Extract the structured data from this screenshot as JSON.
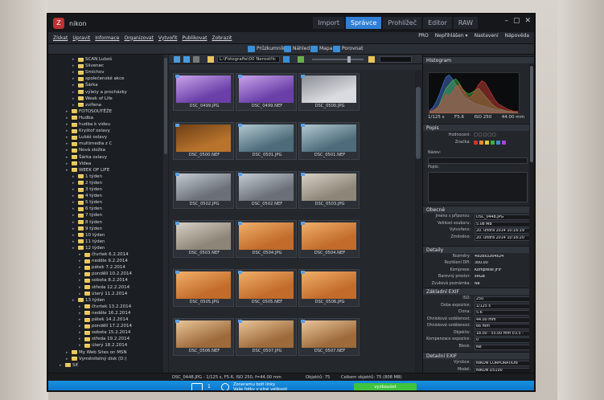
{
  "app": {
    "title": "nikon",
    "logo_letter": "Z"
  },
  "modes": [
    "Import",
    "Správce",
    "Prohlížeč",
    "Editor",
    "RAW"
  ],
  "active_mode": 1,
  "menu": [
    "Získat",
    "Upravit",
    "Informace",
    "Organizovat",
    "Vytvořit",
    "Publikovat",
    "Zobrazit"
  ],
  "menu_right": [
    "PRO",
    "Nepřihlášen ▾",
    "Nastavení",
    "Nápověda"
  ],
  "toolbar": {
    "items": [
      "Průzkumník",
      "Náhled",
      "Mapa",
      "Porovnat"
    ]
  },
  "path": {
    "value": "L:\\Fotografie\\00 Nerostříc"
  },
  "tree": [
    {
      "label": "SCAN Luboš",
      "indent": 2
    },
    {
      "label": "Slivenec",
      "indent": 2
    },
    {
      "label": "Smíchov",
      "indent": 2
    },
    {
      "label": "společenské akce",
      "indent": 2
    },
    {
      "label": "Šárka",
      "indent": 2
    },
    {
      "label": "výlety a procházky",
      "indent": 2
    },
    {
      "label": "Week of Life",
      "indent": 2
    },
    {
      "label": "zvířena",
      "indent": 2
    },
    {
      "label": "FOTOSOUTĚŽE",
      "indent": 1
    },
    {
      "label": "Hudba",
      "indent": 1
    },
    {
      "label": "hudba k videu",
      "indent": 1
    },
    {
      "label": "Kryštof oslavy",
      "indent": 1
    },
    {
      "label": "Lukáš oslavy",
      "indent": 1
    },
    {
      "label": "multimedia z C",
      "indent": 1
    },
    {
      "label": "Nová složka",
      "indent": 1
    },
    {
      "label": "Šárka oslavy",
      "indent": 1
    },
    {
      "label": "Videa",
      "indent": 1
    },
    {
      "label": "WEEK OF LIFE",
      "indent": 1
    },
    {
      "label": "1 týden",
      "indent": 2
    },
    {
      "label": "2 týden",
      "indent": 2
    },
    {
      "label": "3 týden",
      "indent": 2
    },
    {
      "label": "4 týden",
      "indent": 2
    },
    {
      "label": "5 týden",
      "indent": 2
    },
    {
      "label": "6 týden",
      "indent": 2
    },
    {
      "label": "7 týden",
      "indent": 2
    },
    {
      "label": "8 týden",
      "indent": 2
    },
    {
      "label": "9 týden",
      "indent": 2
    },
    {
      "label": "10 týden",
      "indent": 2
    },
    {
      "label": "11 týden",
      "indent": 2
    },
    {
      "label": "12 týden",
      "indent": 2
    },
    {
      "label": "čtvrtek 6.2.2014",
      "indent": 3
    },
    {
      "label": "neděle 9.2.2014",
      "indent": 3
    },
    {
      "label": "pátek 7.2.2014",
      "indent": 3
    },
    {
      "label": "pondělí 10.2.2014",
      "indent": 3
    },
    {
      "label": "sobota 8.2.2014",
      "indent": 3
    },
    {
      "label": "středa 12.2.2014",
      "indent": 3
    },
    {
      "label": "úterý 11.2.2014",
      "indent": 3
    },
    {
      "label": "13 týden",
      "indent": 2
    },
    {
      "label": "čtvrtek 13.2.2014",
      "indent": 3
    },
    {
      "label": "neděle 16.2.2014",
      "indent": 3
    },
    {
      "label": "pátek 14.2.2014",
      "indent": 3
    },
    {
      "label": "pondělí 17.2.2014",
      "indent": 3
    },
    {
      "label": "sobota 15.2.2014",
      "indent": 3
    },
    {
      "label": "středa 19.2.2014",
      "indent": 3
    },
    {
      "label": "úterý 18.2.2014",
      "indent": 3
    },
    {
      "label": "My Web Sites on MSN",
      "indent": 1
    },
    {
      "label": "Vyměnitelný disk (D:)",
      "indent": 1
    },
    {
      "label": "Síť",
      "indent": 0
    }
  ],
  "thumbnails": [
    {
      "name": "DSC_0499.JPG",
      "tone": "purple"
    },
    {
      "name": "DSC_0499.NEF",
      "tone": "purple"
    },
    {
      "name": "DSC_0500.JPG",
      "tone": "snow"
    },
    {
      "name": "DSC_0500.NEF",
      "tone": "wood"
    },
    {
      "name": "DSC_0501.JPG",
      "tone": "pool"
    },
    {
      "name": "DSC_0501.NEF",
      "tone": "pool"
    },
    {
      "name": "DSC_0502.JPG",
      "tone": "sign"
    },
    {
      "name": "DSC_0502.NEF",
      "tone": "sign"
    },
    {
      "name": "DSC_0503.JPG",
      "tone": "stone"
    },
    {
      "name": "DSC_0503.NEF",
      "tone": "stone"
    },
    {
      "name": "DSC_0504.JPG",
      "tone": "chair"
    },
    {
      "name": "DSC_0504.NEF",
      "tone": "chair"
    },
    {
      "name": "DSC_0505.JPG",
      "tone": "chair"
    },
    {
      "name": "DSC_0505.NEF",
      "tone": "chair"
    },
    {
      "name": "DSC_0506.JPG",
      "tone": "chair"
    },
    {
      "name": "DSC_0506.NEF",
      "tone": "room"
    },
    {
      "name": "DSC_0507.JPG",
      "tone": "room"
    },
    {
      "name": "DSC_0507.NEF",
      "tone": "room"
    }
  ],
  "tone_colors": {
    "purple": [
      "#6a3fa8",
      "#c9a3ea"
    ],
    "snow": [
      "#d9dbe0",
      "#8b8e95"
    ],
    "wood": [
      "#b8742d",
      "#6e3f15"
    ],
    "pool": [
      "#4d6b7a",
      "#b2c9d1"
    ],
    "sign": [
      "#6b7078",
      "#c5cbd2"
    ],
    "stone": [
      "#8d8678",
      "#d6d0c4"
    ],
    "chair": [
      "#c26b2a",
      "#f0b06a"
    ],
    "room": [
      "#9d6a3b",
      "#e9c69a"
    ]
  },
  "panel": {
    "histogram_title": "Histogram",
    "exif_summary": [
      "1/125 s",
      "F5.6",
      "ISO 250",
      "44.00 mm"
    ],
    "popis_title": "Popis",
    "hodnoceni_label": "Hodnocení:",
    "znacka_label": "Značka:",
    "nazev_label": "Název:",
    "popis_label": "Popis:",
    "obecne_title": "Obecné",
    "obecne": [
      [
        "Jméno s příponou:",
        "DSC_0448.JPG"
      ],
      [
        "Velikost souboru:",
        "5.08 MB"
      ],
      [
        "Vytvořeno:",
        "20. února 2014 10:16:19"
      ],
      [
        "Změněno:",
        "20. února 2014 10:16:20"
      ]
    ],
    "detail_title": "Detaily",
    "detail": [
      [
        "Rozměry:",
        "4928x3264x24"
      ],
      [
        "Rozlišení DPI:",
        "300.00"
      ],
      [
        "Komprese:",
        "Komprese JFIF"
      ],
      [
        "Barevný prostor:",
        "sRGB"
      ],
      [
        "Zvuková poznámka:",
        "Ne"
      ]
    ],
    "zakladni_title": "Základní EXIF",
    "zakladni": [
      [
        "ISO:",
        "250"
      ],
      [
        "Doba expozice:",
        "1/125 s"
      ],
      [
        "Clona:",
        "5.6"
      ],
      [
        "Ohnisková vzdálenost:",
        "44.00 mm"
      ],
      [
        "Ohnisková vzdálenost:",
        "66 mm"
      ],
      [
        "Objektiv:",
        "18.00 - 55.00 mm f/3.5 -"
      ],
      [
        "Kompenzace expozice:",
        "0"
      ],
      [
        "Blesk:",
        "Ne"
      ]
    ],
    "detailni_title": "Detailní EXIF",
    "detailni": [
      [
        "Výrobce:",
        "NIKON CORPORATION"
      ],
      [
        "Model:",
        "NIKON D5100"
      ],
      [
        "Software:",
        "Ver.1.01"
      ],
      [
        "Program expozice:",
        "Nedefinováno"
      ]
    ]
  },
  "status": {
    "file": "DSC_0448.JPG - 1/125 s, F5.6, ISO 250, f=44.00 mm",
    "objects": "Objektů: 75",
    "total": "Celkem objektů: 75 (808 MB)"
  },
  "notify": {
    "count": "1",
    "line1": "Zoneramu bolt linky",
    "line2": "Vaše fotky v plné velikosti",
    "button": "vyzkoušet"
  },
  "histogram": {
    "red": [
      2,
      3,
      5,
      8,
      14,
      20,
      18,
      22,
      28,
      30,
      26,
      20,
      16,
      18,
      24,
      30,
      34,
      32,
      26,
      20,
      14,
      10,
      8,
      6,
      4,
      3,
      2,
      2
    ],
    "green": [
      1,
      2,
      4,
      9,
      18,
      26,
      30,
      34,
      36,
      32,
      26,
      22,
      20,
      22,
      24,
      26,
      22,
      18,
      14,
      10,
      7,
      5,
      4,
      3,
      2,
      2,
      1,
      1
    ],
    "blue": [
      3,
      6,
      12,
      20,
      30,
      38,
      40,
      36,
      30,
      26,
      20,
      16,
      14,
      12,
      10,
      9,
      8,
      7,
      6,
      5,
      4,
      3,
      3,
      2,
      2,
      1,
      1,
      1
    ]
  }
}
